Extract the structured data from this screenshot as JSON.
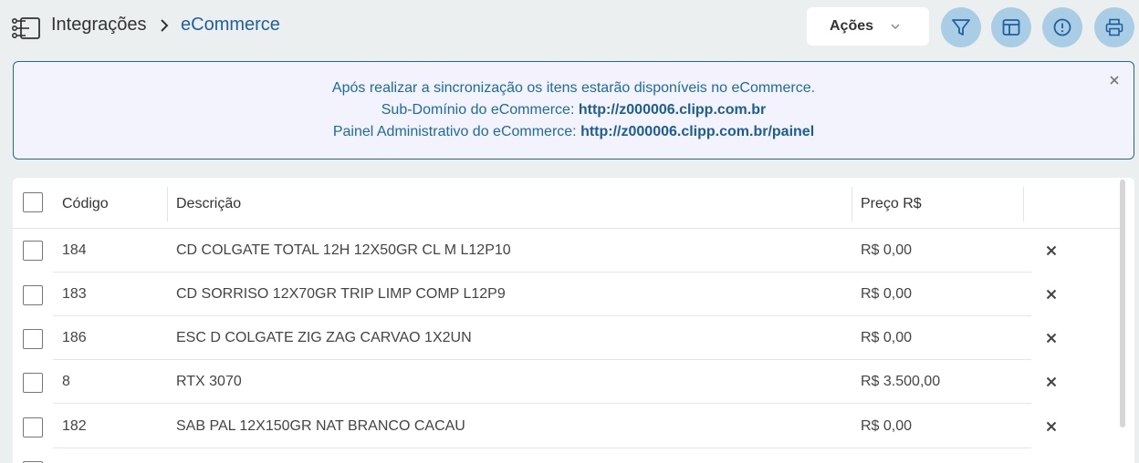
{
  "header": {
    "breadcrumb_root": "Integrações",
    "breadcrumb_current": "eCommerce",
    "acoes_label": "Ações"
  },
  "icons": {
    "app": "integration-flow-icon",
    "separator": "chevron-right-icon",
    "acoes": "chevron-down-icon",
    "filter": "filter-icon",
    "layout": "layout-icon",
    "info": "alert-circle-icon",
    "print": "printer-icon",
    "close": "close-icon",
    "delete": "x-icon"
  },
  "colors": {
    "accent": "#1e5f9f",
    "round_button_bg": "#a9cde4",
    "banner_bg": "#f3f3fd",
    "banner_border": "#1e6a9d"
  },
  "banner": {
    "line1": "Após realizar a sincronização os itens estarão disponíveis no eCommerce.",
    "line2_label": "Sub-Domínio do eCommerce: ",
    "line2_value": "http://z000006.clipp.com.br",
    "line3_label": "Painel Administrativo do eCommerce: ",
    "line3_value": "http://z000006.clipp.com.br/painel"
  },
  "table": {
    "columns": {
      "codigo": "Código",
      "descricao": "Descrição",
      "preco": "Preço R$"
    },
    "rows": [
      {
        "codigo": "184",
        "descricao": "CD COLGATE TOTAL 12H 12X50GR CL M L12P10",
        "preco": "R$ 0,00"
      },
      {
        "codigo": "183",
        "descricao": "CD SORRISO 12X70GR TRIP LIMP COMP L12P9",
        "preco": "R$ 0,00"
      },
      {
        "codigo": "186",
        "descricao": "ESC D COLGATE ZIG ZAG CARVAO 1X2UN",
        "preco": "R$ 0,00"
      },
      {
        "codigo": "8",
        "descricao": "RTX 3070",
        "preco": "R$ 3.500,00"
      },
      {
        "codigo": "182",
        "descricao": "SAB PAL 12X150GR NAT BRANCO CACAU",
        "preco": "R$ 0,00"
      }
    ]
  }
}
